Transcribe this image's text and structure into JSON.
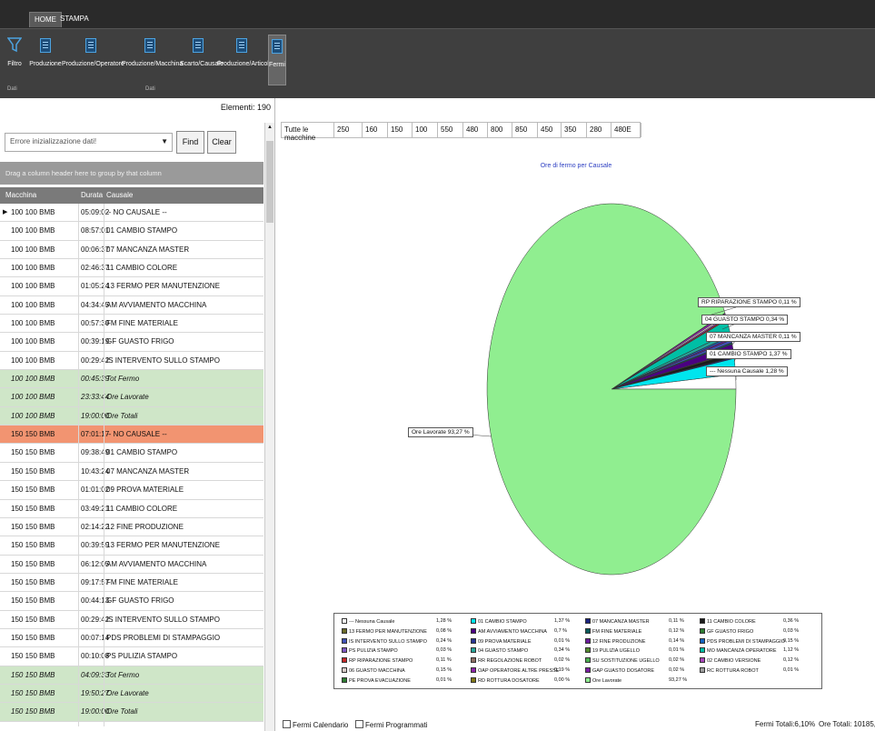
{
  "ribbon": {
    "tabs": [
      "HOME",
      "STAMPA"
    ],
    "buttons": [
      {
        "label": "Filtro",
        "icon": "filter-icon"
      },
      {
        "label": "Produzione",
        "icon": "document-icon"
      },
      {
        "label": "Produzione/Operatore",
        "icon": "document-icon"
      },
      {
        "label": "Produzione/Macchina",
        "icon": "document-icon"
      },
      {
        "label": "Scarto/Causale",
        "icon": "document-icon"
      },
      {
        "label": "Produzione/Articoli",
        "icon": "document-icon"
      },
      {
        "label": "Fermi",
        "icon": "document-icon",
        "active": true
      }
    ],
    "group_labels": [
      "Dati",
      "Dati"
    ]
  },
  "left": {
    "elements_label": "Elementi:",
    "elements_count": "190",
    "filter_value": "Errore inizializzazione dati!",
    "find_label": "Find",
    "clear_label": "Clear",
    "group_hint": "Drag a column header here to group by that column",
    "columns": [
      "Macchina",
      "Durata",
      "Causale"
    ],
    "rows": [
      {
        "m": "100 100 BMB",
        "d": "05:09:02",
        "c": "-- NO CAUSALE --",
        "t": "sel"
      },
      {
        "m": "100 100 BMB",
        "d": "08:57:01",
        "c": "01 CAMBIO STAMPO",
        "t": ""
      },
      {
        "m": "100 100 BMB",
        "d": "00:06:37",
        "c": "07 MANCANZA MASTER",
        "t": ""
      },
      {
        "m": "100 100 BMB",
        "d": "02:46:37",
        "c": "11 CAMBIO COLORE",
        "t": ""
      },
      {
        "m": "100 100 BMB",
        "d": "01:05:24",
        "c": "13 FERMO PER MANUTENZIONE",
        "t": ""
      },
      {
        "m": "100 100 BMB",
        "d": "04:34:45",
        "c": "AM AVVIAMENTO MACCHINA",
        "t": ""
      },
      {
        "m": "100 100 BMB",
        "d": "00:57:30",
        "c": "FM FINE MATERIALE",
        "t": ""
      },
      {
        "m": "100 100 BMB",
        "d": "00:39:19",
        "c": "GF GUASTO FRIGO",
        "t": ""
      },
      {
        "m": "100 100 BMB",
        "d": "00:29:42",
        "c": "IS INTERVENTO SULLO STAMPO",
        "t": ""
      },
      {
        "m": "100 100 BMB",
        "d": "00:45:39",
        "c": "Tot Fermo",
        "t": "tot"
      },
      {
        "m": "100 100 BMB",
        "d": "23:33:44",
        "c": "Ore Lavorate",
        "t": "tot"
      },
      {
        "m": "100 100 BMB",
        "d": "19:00:00",
        "c": "Ore Totali",
        "t": "tot"
      },
      {
        "m": "150 150 BMB",
        "d": "07:01:17",
        "c": "-- NO CAUSALE --",
        "t": "nc"
      },
      {
        "m": "150 150 BMB",
        "d": "09:38:49",
        "c": "01 CAMBIO STAMPO",
        "t": ""
      },
      {
        "m": "150 150 BMB",
        "d": "10:43:24",
        "c": "07 MANCANZA MASTER",
        "t": ""
      },
      {
        "m": "150 150 BMB",
        "d": "01:01:02",
        "c": "09 PROVA MATERIALE",
        "t": ""
      },
      {
        "m": "150 150 BMB",
        "d": "03:49:21",
        "c": "11 CAMBIO COLORE",
        "t": ""
      },
      {
        "m": "150 150 BMB",
        "d": "02:14:22",
        "c": "12 FINE PRODUZIONE",
        "t": ""
      },
      {
        "m": "150 150 BMB",
        "d": "00:39:59",
        "c": "13 FERMO PER MANUTENZIONE",
        "t": ""
      },
      {
        "m": "150 150 BMB",
        "d": "06:12:05",
        "c": "AM AVVIAMENTO MACCHINA",
        "t": ""
      },
      {
        "m": "150 150 BMB",
        "d": "09:17:57",
        "c": "FM FINE MATERIALE",
        "t": ""
      },
      {
        "m": "150 150 BMB",
        "d": "00:44:13",
        "c": "GF GUASTO FRIGO",
        "t": ""
      },
      {
        "m": "150 150 BMB",
        "d": "00:29:42",
        "c": "IS INTERVENTO SULLO STAMPO",
        "t": ""
      },
      {
        "m": "150 150 BMB",
        "d": "00:07:14",
        "c": "PDS PROBLEMI DI STAMPAGGIO",
        "t": ""
      },
      {
        "m": "150 150 BMB",
        "d": "00:10:08",
        "c": "PS PULIZIA STAMPO",
        "t": ""
      },
      {
        "m": "150 150 BMB",
        "d": "04:09:33",
        "c": "Tot Fermo",
        "t": "tot"
      },
      {
        "m": "150 150 BMB",
        "d": "19:50:27",
        "c": "Ore Lavorate",
        "t": "tot"
      },
      {
        "m": "150 150 BMB",
        "d": "19:00:00",
        "c": "Ore Totali",
        "t": "tot"
      }
    ]
  },
  "right": {
    "machines_label": "Tutte le macchine",
    "machines": [
      "250",
      "160",
      "150",
      "100",
      "550",
      "480",
      "800",
      "850",
      "450",
      "350",
      "280",
      "480E"
    ],
    "fermi_calendario": "Fermi Calendario",
    "fermi_programmati": "Fermi Programmati",
    "fermi_totali": "Fermi Totali:6,10%",
    "ore_totali": "Ore Totali: 10185,00,0"
  },
  "chart_data": {
    "type": "pie",
    "title": "Ore di fermo per Causale",
    "slices": [
      {
        "label": "--- Nessuna Causale",
        "value": 1.28,
        "color": "#ffffff"
      },
      {
        "label": "01 CAMBIO STAMPO",
        "value": 1.37,
        "color": "#00e5ee"
      },
      {
        "label": "07 MANCANZA MASTER",
        "value": 0.11,
        "color": "#1a237e"
      },
      {
        "label": "11 CAMBIO COLORE",
        "value": 0.36,
        "color": "#1b1b1b"
      },
      {
        "label": "13 FERMO PER MANUTENZIONE",
        "value": 0.08,
        "color": "#6b6b2a"
      },
      {
        "label": "AM AVVIAMENTO MACCHINA",
        "value": 0.7,
        "color": "#4b0082"
      },
      {
        "label": "FM FINE MATERIALE",
        "value": 0.12,
        "color": "#0a5a5a"
      },
      {
        "label": "GF GUASTO FRIGO",
        "value": 0.03,
        "color": "#2e7d32"
      },
      {
        "label": "IS INTERVENTO SULLO STAMPO",
        "value": 0.24,
        "color": "#3f51b5"
      },
      {
        "label": "09 PROVA MATERIALE",
        "value": 0.01,
        "color": "#283593"
      },
      {
        "label": "12 FINE PRODUZIONE",
        "value": 0.14,
        "color": "#6a1b9a"
      },
      {
        "label": "PDS PROBLEMI DI STAMPAGGIO",
        "value": 0.15,
        "color": "#1565c0"
      },
      {
        "label": "PS PULIZIA STAMPO",
        "value": 0.03,
        "color": "#7e57c2"
      },
      {
        "label": "04 GUASTO STAMPO",
        "value": 0.34,
        "color": "#26a69a"
      },
      {
        "label": "19 PULIZIA UGELLO",
        "value": 0.01,
        "color": "#558b2f"
      },
      {
        "label": "MO MANCANZA OPERATORE",
        "value": 1.12,
        "color": "#00bfa5"
      },
      {
        "label": "RP RIPARAZIONE STAMPO",
        "value": 0.11,
        "color": "#c62828"
      },
      {
        "label": "RR REGOLAZIONE ROBOT",
        "value": 0.02,
        "color": "#8d6e63"
      },
      {
        "label": "SU SOSTITUZIONE UGELLO",
        "value": 0.02,
        "color": "#4caf50"
      },
      {
        "label": "02 CAMBIO VERSIONE",
        "value": 0.12,
        "color": "#ab47bc"
      },
      {
        "label": "06 GUASTO MACCHINA",
        "value": 0.15,
        "color": "#d7ccc8"
      },
      {
        "label": "OAP OPERATORE ALTRE PRESSE",
        "value": 0.19,
        "color": "#8e24aa"
      },
      {
        "label": "GAP GUASTO DOSATORE",
        "value": 0.02,
        "color": "#7b1fa2"
      },
      {
        "label": "RC ROTTURA ROBOT",
        "value": 0.01,
        "color": "#9e9e9e"
      },
      {
        "label": "PE PROVA EVACUAZIONE",
        "value": 0.01,
        "color": "#2e7d32"
      },
      {
        "label": "RD ROTTURA DOSATORE",
        "value": 0.0,
        "color": "#827717"
      },
      {
        "label": "Ore Lavorate",
        "value": 93.27,
        "color": "#90ee90"
      }
    ],
    "callouts": [
      {
        "text": "RP RIPARAZIONE STAMPO 0,11 %"
      },
      {
        "text": "04 GUASTO STAMPO 0,34 %"
      },
      {
        "text": "07 MANCANZA MASTER 0,11 %"
      },
      {
        "text": "01 CAMBIO STAMPO 1,37 %"
      },
      {
        "text": "--- Nessuna Causale 1,28 %"
      },
      {
        "text": "Ore Lavorate 93,27 %"
      }
    ],
    "legend": [
      {
        "label": "--- Nessuna Causale",
        "pct": "1,28 %",
        "color": "#ffffff"
      },
      {
        "label": "01 CAMBIO STAMPO",
        "pct": "1,37 %",
        "color": "#00e5ee"
      },
      {
        "label": "07 MANCANZA MASTER",
        "pct": "0,11 %",
        "color": "#1a237e"
      },
      {
        "label": "11 CAMBIO COLORE",
        "pct": "0,36 %",
        "color": "#1b1b1b"
      },
      {
        "label": "13 FERMO PER MANUTENZIONE",
        "pct": "0,08 %",
        "color": "#6b6b2a"
      },
      {
        "label": "AM AVVIAMENTO MACCHINA",
        "pct": "0,7 %",
        "color": "#4b0082"
      },
      {
        "label": "FM FINE MATERIALE",
        "pct": "0,12 %",
        "color": "#0a5a5a"
      },
      {
        "label": "GF GUASTO FRIGO",
        "pct": "0,03 %",
        "color": "#2e7d32"
      },
      {
        "label": "IS INTERVENTO SULLO STAMPO",
        "pct": "0,24 %",
        "color": "#3f51b5"
      },
      {
        "label": "09 PROVA MATERIALE",
        "pct": "0,01 %",
        "color": "#283593"
      },
      {
        "label": "12 FINE PRODUZIONE",
        "pct": "0,14 %",
        "color": "#6a1b9a"
      },
      {
        "label": "PDS PROBLEMI DI STAMPAGGIO",
        "pct": "0,15 %",
        "color": "#1565c0"
      },
      {
        "label": "PS PULIZIA STAMPO",
        "pct": "0,03 %",
        "color": "#7e57c2"
      },
      {
        "label": "04 GUASTO STAMPO",
        "pct": "0,34 %",
        "color": "#26a69a"
      },
      {
        "label": "19 PULIZIA UGELLO",
        "pct": "0,01 %",
        "color": "#558b2f"
      },
      {
        "label": "MO MANCANZA OPERATORE",
        "pct": "1,12 %",
        "color": "#00bfa5"
      },
      {
        "label": "RP RIPARAZIONE STAMPO",
        "pct": "0,11 %",
        "color": "#c62828"
      },
      {
        "label": "RR REGOLAZIONE ROBOT",
        "pct": "0,02 %",
        "color": "#8d6e63"
      },
      {
        "label": "SU SOSTITUZIONE UGELLO",
        "pct": "0,02 %",
        "color": "#4caf50"
      },
      {
        "label": "02 CAMBIO VERSIONE",
        "pct": "0,12 %",
        "color": "#ab47bc"
      },
      {
        "label": "06 GUASTO MACCHINA",
        "pct": "0,15 %",
        "color": "#d7ccc8"
      },
      {
        "label": "OAP OPERATORE ALTRE PRESSE",
        "pct": "0,19 %",
        "color": "#8e24aa"
      },
      {
        "label": "GAP GUASTO DOSATORE",
        "pct": "0,02 %",
        "color": "#7b1fa2"
      },
      {
        "label": "RC ROTTURA ROBOT",
        "pct": "0,01 %",
        "color": "#9e9e9e"
      },
      {
        "label": "PE PROVA EVACUAZIONE",
        "pct": "0,01 %",
        "color": "#2e7d32"
      },
      {
        "label": "RD ROTTURA DOSATORE",
        "pct": "0,00 %",
        "color": "#827717"
      },
      {
        "label": "Ore Lavorate",
        "pct": "93,27 %",
        "color": "#90ee90"
      }
    ]
  }
}
